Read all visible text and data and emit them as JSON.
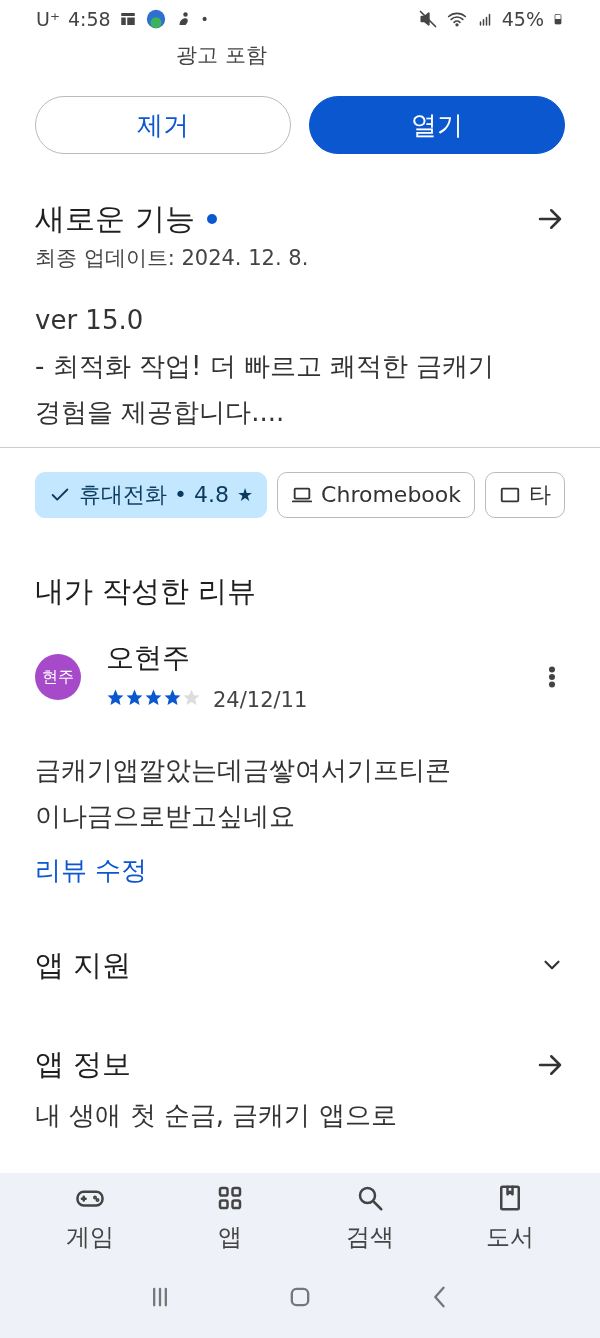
{
  "status_bar": {
    "carrier": "U⁺",
    "time": "4:58",
    "dot": "•",
    "battery": "45%"
  },
  "ad_notice": "광고 포함",
  "action_buttons": [
    {
      "label": "제거",
      "kind": "outline"
    },
    {
      "label": "열기",
      "kind": "filled"
    }
  ],
  "whats_new": {
    "title": "새로운 기능",
    "updated": "최종 업데이트: 2024. 12. 8.",
    "lines": [
      "ver 15.0",
      "- 최적화 작업! 더 빠르고 쾌적한 금캐기",
      "경험을 제공합니다...."
    ]
  },
  "device_chips": [
    {
      "kind": "phone",
      "label": "휴대전화 • 4.8",
      "star": "★",
      "selected": true
    },
    {
      "kind": "laptop",
      "label": "Chromebook",
      "selected": false
    },
    {
      "kind": "tablet",
      "label": "타",
      "selected": false
    }
  ],
  "my_review": {
    "heading": "내가 작성한 리뷰",
    "avatar": "현주",
    "author": "오현주",
    "stars": 4,
    "date": "24/12/11",
    "text_lines": [
      "금캐기앱깔았는데금쌓여서기프티콘",
      "이나금으로받고싶네요"
    ],
    "edit_link": "리뷰 수정"
  },
  "sections": [
    {
      "title": "앱 지원",
      "kind": "expand"
    },
    {
      "title": "앱 정보",
      "kind": "arrow"
    }
  ],
  "cut_text": "내 생애 첫 순금, 금캐기 앱으로",
  "bottom_nav": [
    {
      "kind": "games",
      "label": "게임"
    },
    {
      "kind": "apps",
      "label": "앱"
    },
    {
      "kind": "search",
      "label": "검색"
    },
    {
      "kind": "books",
      "label": "도서"
    }
  ]
}
